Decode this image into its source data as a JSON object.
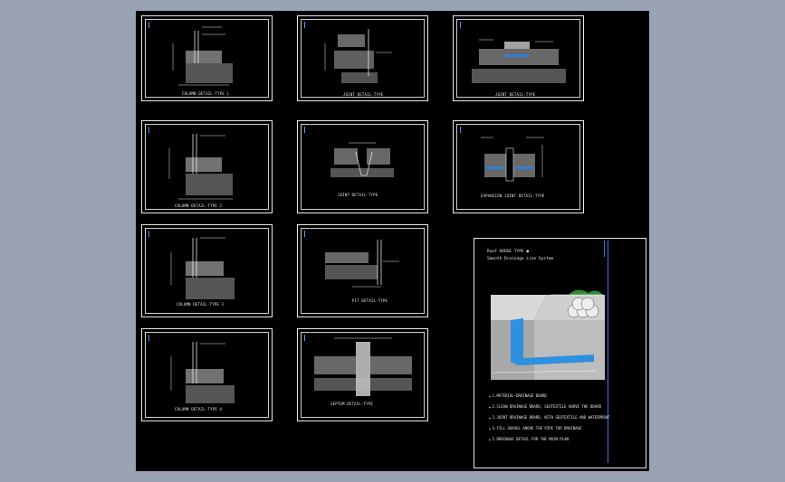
{
  "drawing": {
    "details": [
      {
        "id": "d1",
        "caption": "COLUMN DETAIL-TYPE 1"
      },
      {
        "id": "d2",
        "caption": "JOINT DETAIL-TYPE"
      },
      {
        "id": "d3",
        "caption": "JOINT DETAIL-TYPE"
      },
      {
        "id": "d4",
        "caption": "COLUMN DETAIL-TYPE 2"
      },
      {
        "id": "d5",
        "caption": "JOINT DETAIL-TYPE"
      },
      {
        "id": "d6",
        "caption": "EXPANSION JOINT DETAIL-TYPE"
      },
      {
        "id": "d7",
        "caption": "COLUMN DETAIL-TYPE 3"
      },
      {
        "id": "d8",
        "caption": "PIT DETAIL-TYPE"
      },
      {
        "id": "d9",
        "caption": "COLUMN DETAIL-TYPE 4"
      },
      {
        "id": "d10",
        "caption": "SEPTUM DETAIL-TYPE"
      }
    ],
    "panel": {
      "title_line1": "Roof HOUSE TYPE ●",
      "title_line2": "Smooth Drainage Line System",
      "notes": [
        "1.MATERIAL-DRAINAGE BOARD",
        "2.CLEAN DRAINAGE BOARD, GEOTEXTILE ABOVE THE BOARD",
        "3.JOINT DRAINAGE BOARD, WITH GEOTEXTILE AND WATERPROOF",
        "4.FILL GRAVEL ABOVE THE PIPE FOR DRAINAGE",
        "5.DRAINAGE DETAIL FOR THE MAIN PLAN"
      ]
    },
    "colors": {
      "background": "#9aa3b3",
      "sheet": "#000000",
      "line": "#e8e8e8",
      "accent": "#2f7fd8",
      "hatch": "#cfcfcf"
    }
  }
}
